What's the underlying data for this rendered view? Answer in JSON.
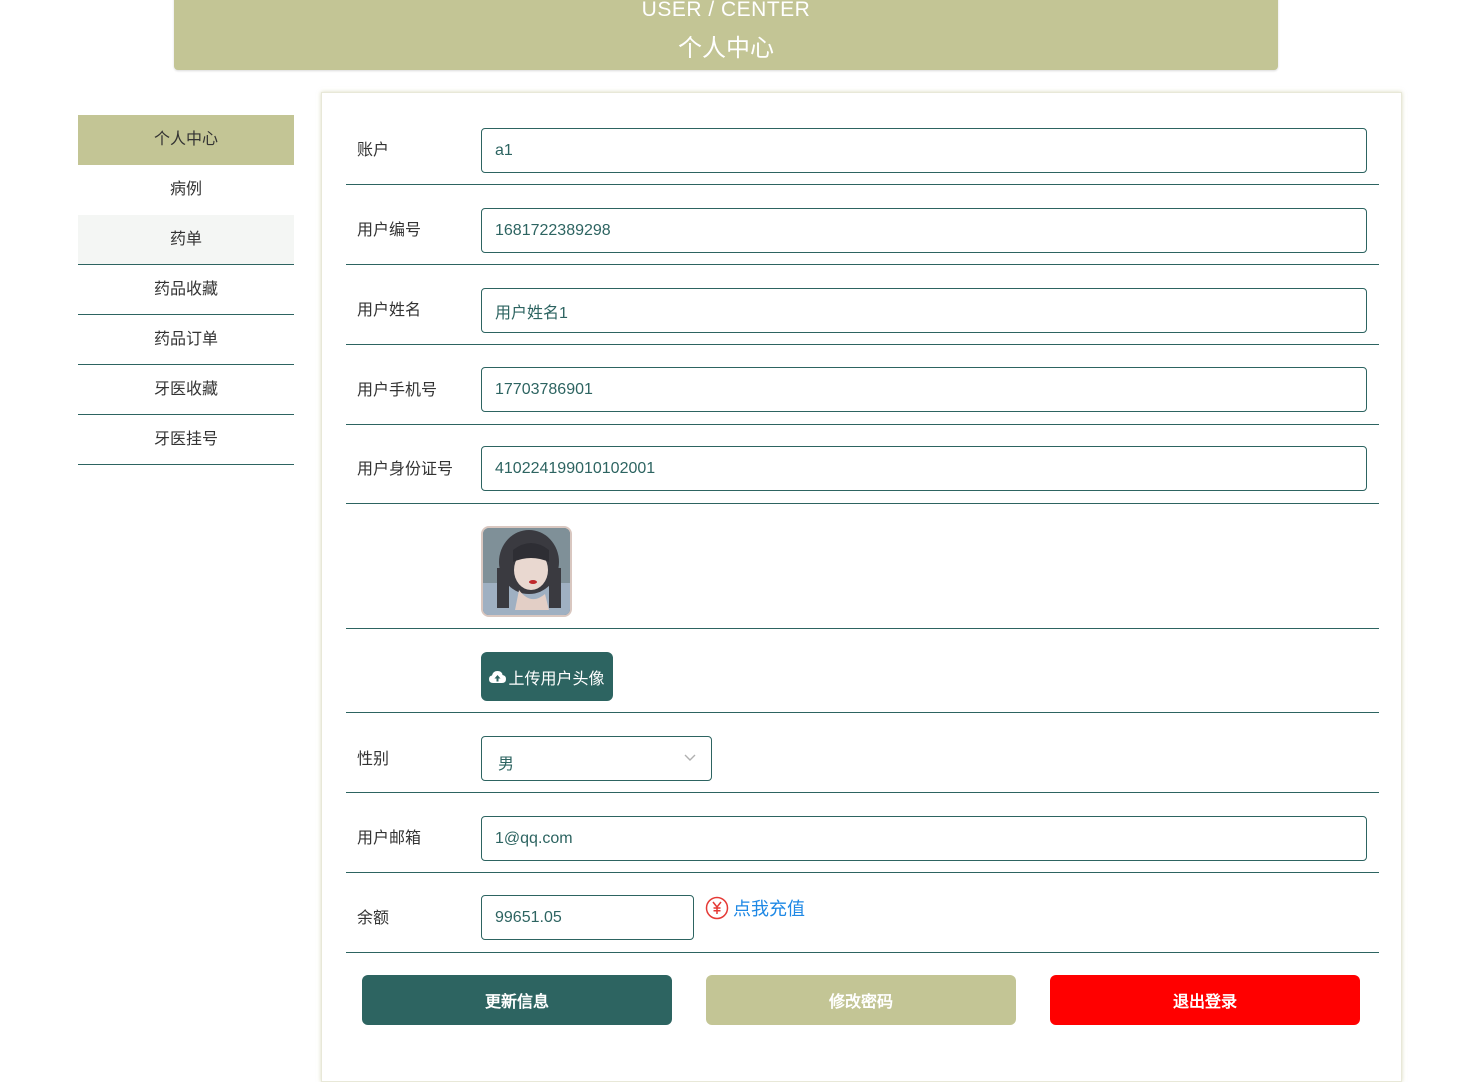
{
  "header": {
    "title_en": "USER / CENTER",
    "title_zh": "个人中心"
  },
  "sidebar": {
    "items": [
      {
        "label": "个人中心",
        "state": "active"
      },
      {
        "label": "病例",
        "state": "normal"
      },
      {
        "label": "药单",
        "state": "hover"
      },
      {
        "label": "药品收藏",
        "state": "normal"
      },
      {
        "label": "药品订单",
        "state": "normal"
      },
      {
        "label": "牙医收藏",
        "state": "normal"
      },
      {
        "label": "牙医挂号",
        "state": "normal"
      }
    ]
  },
  "form": {
    "account": {
      "label": "账户",
      "value": "a1"
    },
    "user_id": {
      "label": "用户编号",
      "value": "1681722389298"
    },
    "user_name": {
      "label": "用户姓名",
      "value": "用户姓名1"
    },
    "phone": {
      "label": "用户手机号",
      "value": "17703786901"
    },
    "id_card": {
      "label": "用户身份证号",
      "value": "410224199010102001"
    },
    "upload_label": "上传用户头像",
    "gender": {
      "label": "性别",
      "value": "男"
    },
    "email": {
      "label": "用户邮箱",
      "value": "1@qq.com"
    },
    "balance": {
      "label": "余额",
      "value": "99651.05"
    },
    "recharge_label": "点我充值"
  },
  "actions": {
    "update": "更新信息",
    "change_password": "修改密码",
    "logout": "退出登录"
  },
  "colors": {
    "primary": "#2d6461",
    "accent": "#c3c595",
    "danger": "#ff0000",
    "link": "#1e88e5"
  },
  "icons": {
    "upload": "cloud-upload-icon",
    "recharge": "yuan-circle-icon",
    "select": "chevron-down-icon"
  }
}
